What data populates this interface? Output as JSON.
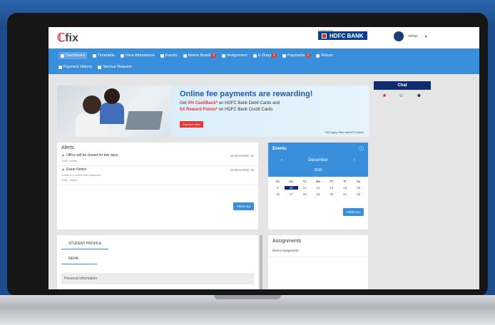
{
  "header": {
    "logo": "fix",
    "bank_powered": "Powered by",
    "bank_name": "HDFC BANK",
    "user_name": "nehas"
  },
  "nav": {
    "row1": [
      {
        "label": "Dashboard",
        "icon": "dashboard-icon",
        "active": true
      },
      {
        "label": "Timetable",
        "icon": "calendar-icon"
      },
      {
        "label": "View Attendance",
        "icon": "clock-icon"
      },
      {
        "label": "Events",
        "icon": "events-icon"
      },
      {
        "label": "Notice Board",
        "icon": "bell-icon",
        "badge": "2"
      },
      {
        "label": "Assignment",
        "icon": "pencil-icon"
      },
      {
        "label": "E-Diary",
        "icon": "book-icon",
        "badge": "1"
      },
      {
        "label": "Payments",
        "icon": "rupee-icon",
        "badge": "1"
      },
      {
        "label": "Return",
        "icon": "return-icon"
      }
    ],
    "row2": [
      {
        "label": "Payment History",
        "icon": "history-icon"
      },
      {
        "label": "Service Request",
        "icon": "request-icon"
      }
    ]
  },
  "banner": {
    "title": "Online fee payments are rewarding!",
    "line2_pre": "Get ",
    "line2_hl": "5% CashBack*",
    "line2_post": " on HDFC Bank Debit Cards and",
    "line3_hl": "5X Reward Points*",
    "line3_post": " on HDFC Bank Credit Cards",
    "button": "Pay fees here",
    "tc": "*T&C apply. Offer valid till 31 March"
  },
  "chat": {
    "title": "Chat",
    "icons": [
      "message-icon",
      "group-icon",
      "add-user-icon"
    ]
  },
  "alerts": {
    "title": "Alerts",
    "items": [
      {
        "title": "Office will be closed for two days.",
        "date": "15 December 15",
        "by": "Post : nehas",
        "sub": ""
      },
      {
        "title": "Exam Notice",
        "date": "15 December 15",
        "by": "Post : nehas",
        "sub": "There is a maths test tomorrow"
      }
    ],
    "view_all": "VIEW ALL"
  },
  "events": {
    "title": "Events",
    "month": "December",
    "year": "2015",
    "days": [
      "Su",
      "Mo",
      "Tu",
      "We",
      "Th",
      "Fr",
      "Sa"
    ],
    "week1": [
      "9",
      "10",
      "11",
      "12",
      "13",
      "14",
      "15"
    ],
    "week2": [
      "16",
      "17",
      "18",
      "19",
      "20",
      "21",
      "22"
    ],
    "today": "10",
    "view_all": "VIEW ALL"
  },
  "profile": {
    "tab": "STUDENT PROFILE",
    "name": "NEHA",
    "section": "Personal Information"
  },
  "assignments": {
    "title": "Assignments",
    "item": "Demo Assignment"
  }
}
